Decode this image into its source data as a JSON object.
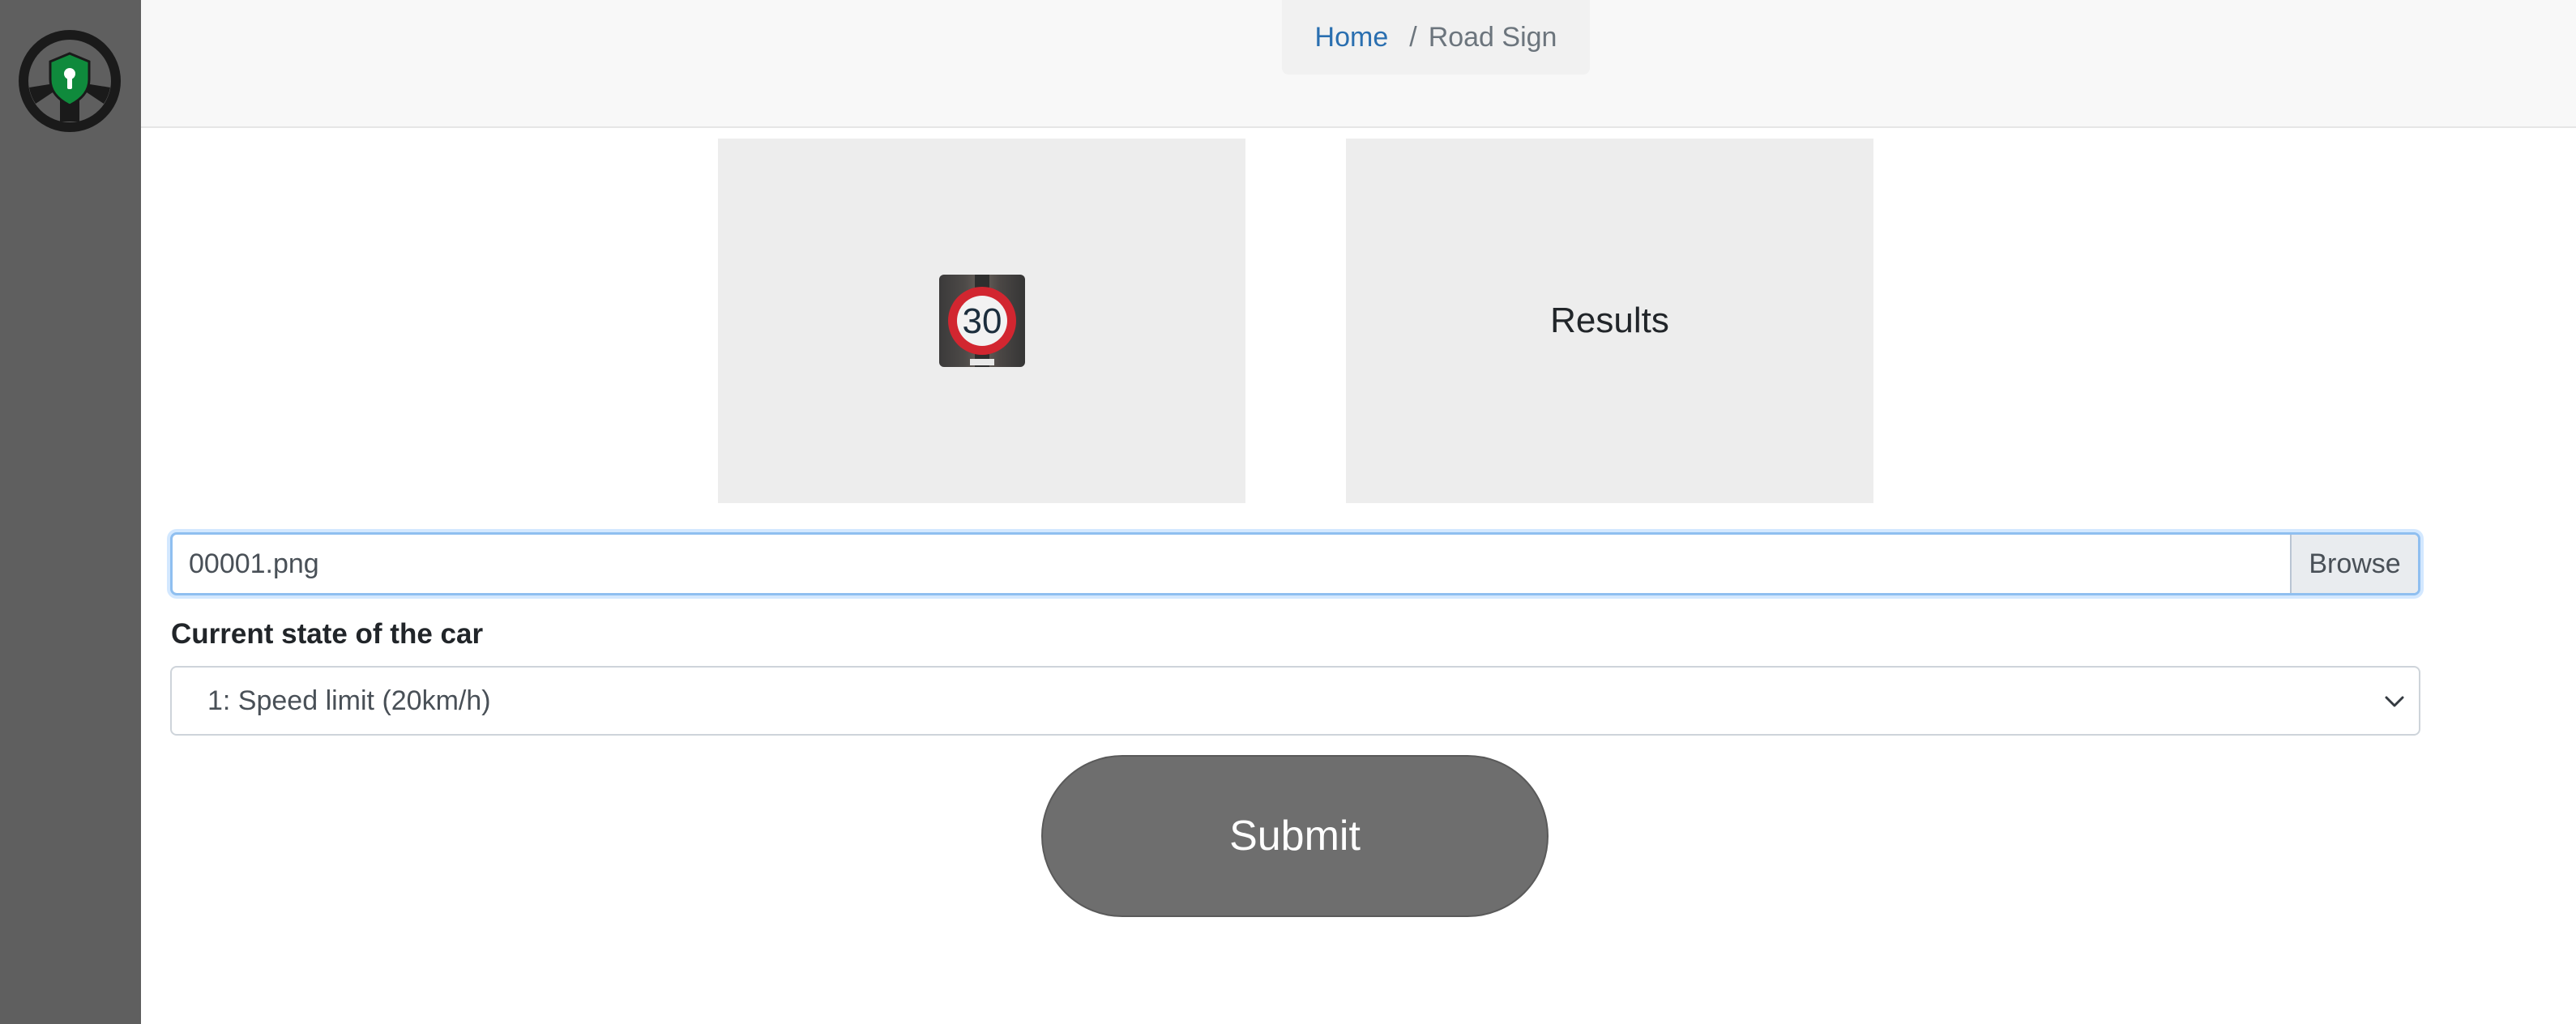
{
  "breadcrumb": {
    "home": "Home",
    "separator": "/",
    "current": "Road Sign"
  },
  "preview": {
    "sign_text": "30"
  },
  "results": {
    "label": "Results"
  },
  "file_input": {
    "value": "00001.png",
    "browse_label": "Browse"
  },
  "car_state": {
    "label": "Current state of the car",
    "selected": "1: Speed limit (20km/h)"
  },
  "submit_label": "Submit",
  "colors": {
    "sidebar": "#5f5f5f",
    "logo_green": "#0f8a3c",
    "link": "#2a6fb0",
    "submit": "#6e6e6e",
    "focus_border": "#8fbff0"
  },
  "icons": {
    "logo": "steering-wheel-shield-keyhole-icon",
    "select_arrow": "chevron-down-icon"
  }
}
